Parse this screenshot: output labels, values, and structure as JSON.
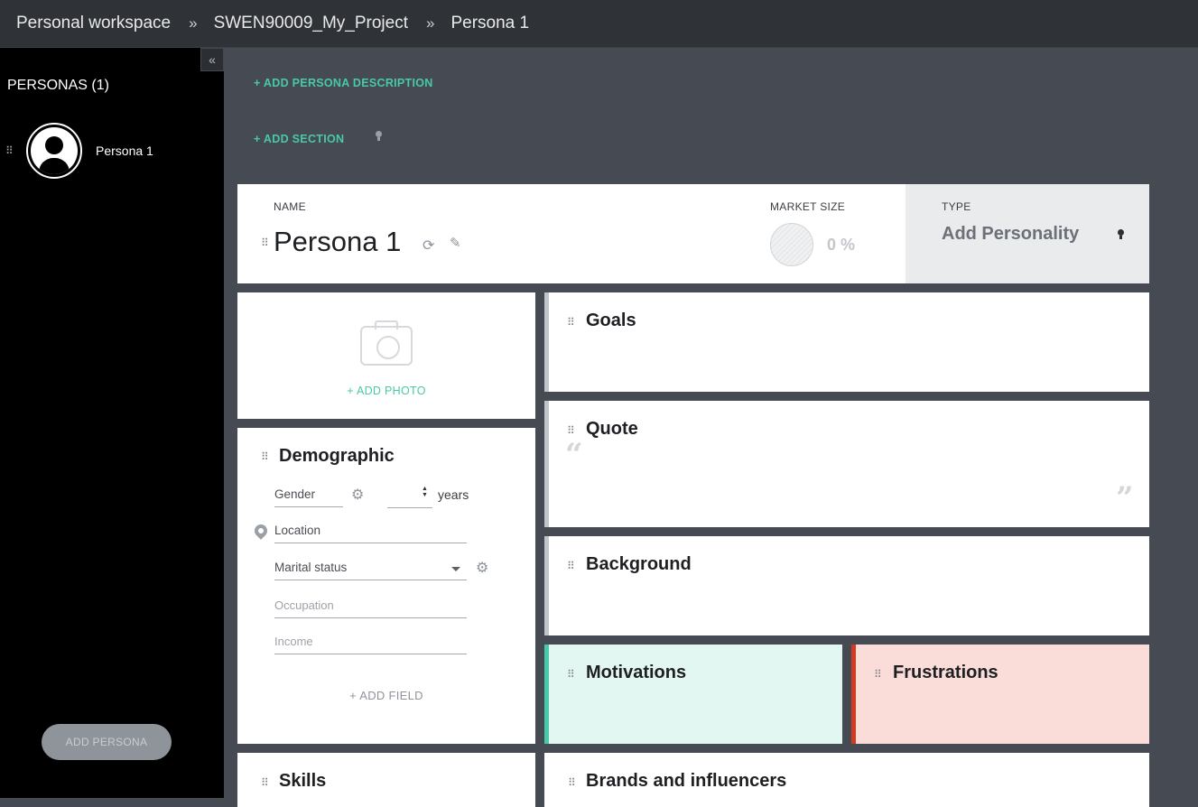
{
  "breadcrumb": {
    "workspace": "Personal workspace",
    "project": "SWEN90009_My_Project",
    "current": "Persona 1",
    "separator": "»"
  },
  "sidebar": {
    "collapse_glyph": "«",
    "title": "PERSONAS (1)",
    "personas": [
      {
        "name": "Persona 1",
        "icon": "user-avatar-icon"
      }
    ],
    "add_button": "ADD PERSONA"
  },
  "actions": {
    "add_description": "+ ADD PERSONA DESCRIPTION",
    "add_section": "+ ADD SECTION"
  },
  "header": {
    "name_label": "NAME",
    "name_value": "Persona 1",
    "market_label": "MARKET SIZE",
    "market_value": "0 %",
    "type_label": "TYPE",
    "type_value": "Add Personality"
  },
  "photo": {
    "add_label": "+ ADD PHOTO",
    "icon": "camera-icon"
  },
  "demographic": {
    "title": "Demographic",
    "gender": "Gender",
    "years": "years",
    "location": "Location",
    "marital_status": "Marital status",
    "occupation": "Occupation",
    "income": "Income",
    "add_field": "+ ADD FIELD"
  },
  "sections": {
    "goals": "Goals",
    "quote": "Quote",
    "background": "Background",
    "motivations": "Motivations",
    "frustrations": "Frustrations",
    "skills": "Skills",
    "brands": "Brands and influencers"
  },
  "colors": {
    "accent": "#48c9a7",
    "frustration": "#d33a22",
    "motivation_bg": "#e3f7f2",
    "frustration_bg": "#fadcd8"
  }
}
